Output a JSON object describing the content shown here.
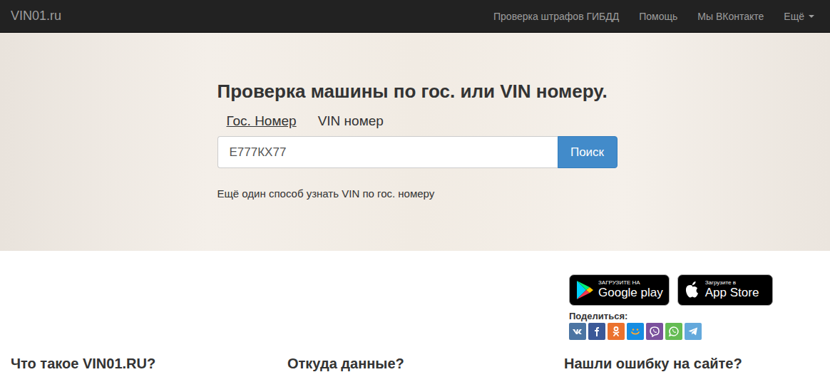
{
  "navbar": {
    "brand": "VIN01.ru",
    "links": [
      {
        "label": "Проверка штрафов ГИБДД",
        "dropdown": false
      },
      {
        "label": "Помощь",
        "dropdown": false
      },
      {
        "label": "Мы ВКонтакте",
        "dropdown": false
      },
      {
        "label": "Ещё",
        "dropdown": true
      }
    ]
  },
  "hero": {
    "title": "Проверка машины по гос. или VIN номеру.",
    "tabs": [
      {
        "label": "Гос. Номер",
        "selected": true
      },
      {
        "label": "VIN номер",
        "selected": false
      }
    ],
    "search": {
      "value": "Е777КХ77",
      "button": "Поиск"
    },
    "link": "Ещё один способ узнать VIN по гос. номеру"
  },
  "stores": [
    {
      "kind": "google",
      "small": "ЗАГРУЗИТЕ НА",
      "big": "Google play"
    },
    {
      "kind": "apple",
      "small": "Загрузите в",
      "big": "App Store"
    }
  ],
  "share": {
    "label": "Поделиться:",
    "networks": [
      {
        "kind": "vk",
        "color": "#4c75a3"
      },
      {
        "kind": "facebook",
        "color": "#3b5998"
      },
      {
        "kind": "ok",
        "color": "#eb722e"
      },
      {
        "kind": "moimir",
        "color": "#168de2"
      },
      {
        "kind": "viber",
        "color": "#7b519d"
      },
      {
        "kind": "whatsapp",
        "color": "#65bc54"
      },
      {
        "kind": "telegram",
        "color": "#64a9dc"
      }
    ]
  },
  "sections": [
    {
      "title": "Что такое VIN01.RU?"
    },
    {
      "title": "Откуда данные?"
    },
    {
      "title": "Нашли ошибку на сайте?"
    }
  ]
}
